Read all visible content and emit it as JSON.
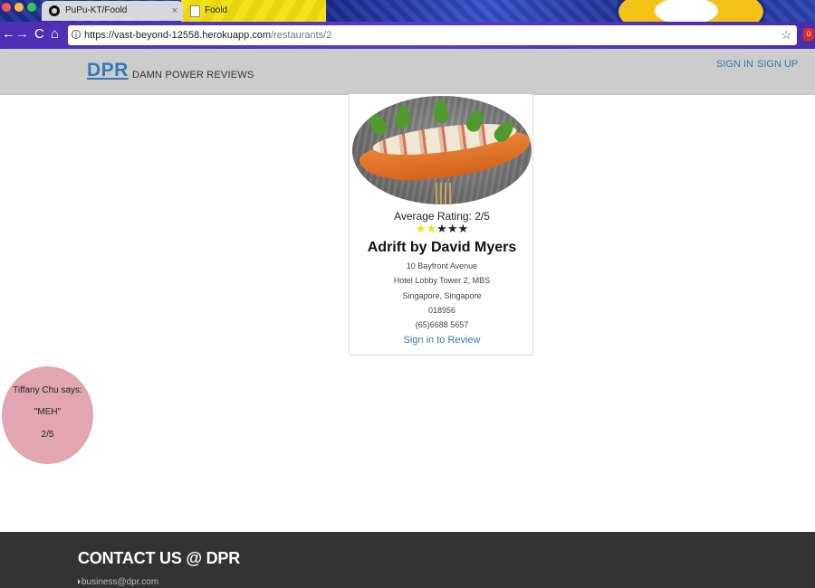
{
  "browser": {
    "tabs": [
      {
        "title": "PuPu-KT/Foold",
        "icon": "github-icon",
        "active": true
      },
      {
        "title": "Foold",
        "icon": "document-icon",
        "active": false
      }
    ],
    "close_glyph": "×",
    "url": {
      "host": "https://vast-beyond-12558.herokuapp.com",
      "path": "/restaurants/2"
    },
    "nav_glyphs": {
      "back": "←",
      "forward": "→",
      "reload": "C",
      "home": "⌂",
      "info": "i",
      "bookmark": "☆"
    },
    "extension_label": "ü"
  },
  "header": {
    "logo": "DPR",
    "tagline": "DAMN POWER REVIEWS",
    "nav": {
      "signin": "SIGN IN",
      "signup": "SIGN UP"
    }
  },
  "restaurant": {
    "average_rating_label": "Average Rating: 2/5",
    "rating": 2,
    "max_rating": 5,
    "star_glyph": "★",
    "name": "Adrift by David Myers",
    "address": {
      "line1": "10 Bayfront Avenue",
      "line2": "Hotel Lobby Tower 2, MBS",
      "line3": "Singapore, Singapore",
      "postal": "018956",
      "phone": "(65)6688 5657"
    },
    "review_link": "Sign in to Review"
  },
  "review": {
    "author_line": "Tiffany Chu says:",
    "quote": "\"MEH\"",
    "score": "2/5"
  },
  "footer": {
    "title": "CONTACT US @ DPR",
    "email": "business@dpr.com"
  },
  "colors": {
    "brand_blue": "#337ab7",
    "header_gray": "#cccccc",
    "footer_dark": "#333333",
    "star_filled": "#f2e10c",
    "bubble_pink": "#e2a5b2"
  }
}
